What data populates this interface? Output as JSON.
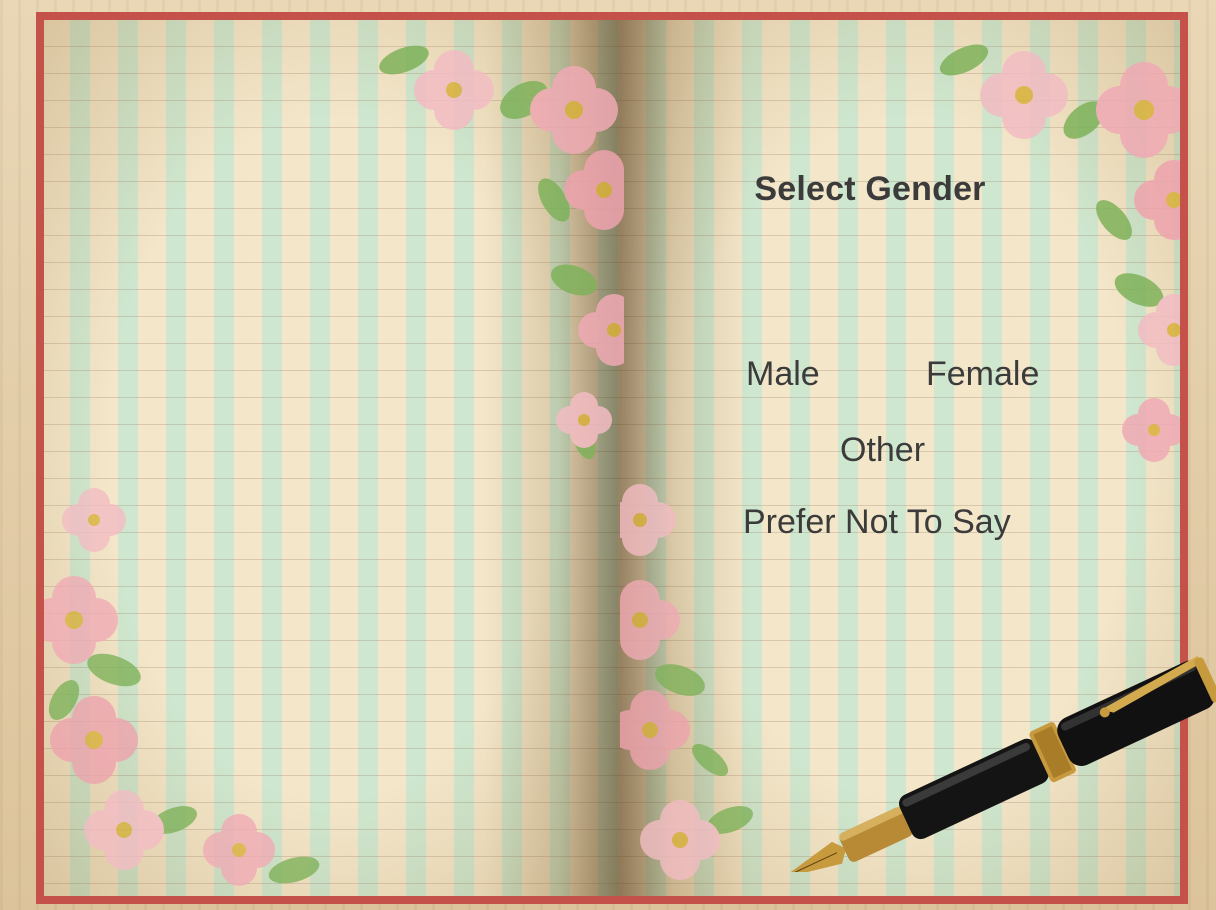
{
  "screen": {
    "title": "Select Gender"
  },
  "options": [
    {
      "label": "Male"
    },
    {
      "label": "Female"
    },
    {
      "label": "Other"
    },
    {
      "label": "Prefer Not To Say"
    }
  ],
  "colors": {
    "book_border": "#c4524a",
    "text": "#3b3b3b",
    "stripe_green": "#cfe7cf",
    "stripe_cream": "#f3e6c9",
    "flower_pink": "#f2b8bf",
    "leaf_green": "#74a84c"
  },
  "icons": {
    "pen": "fountain-pen-icon",
    "flowers": "floral-corner-decoration"
  }
}
